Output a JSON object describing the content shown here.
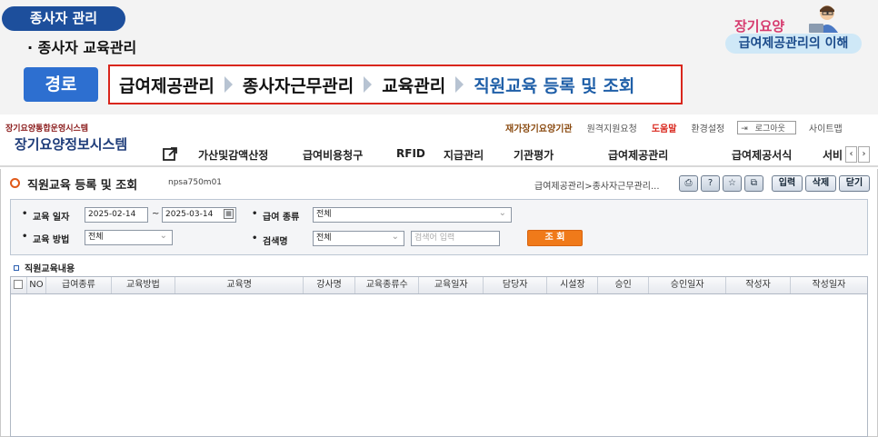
{
  "lecture": {
    "section_pill": "종사자 관리",
    "subtitle": "· 종사자 교육관리",
    "logo_text": "장기요양",
    "badge": "급여제공관리의 이해",
    "route_label": "경로",
    "route_path": [
      "급여제공관리",
      "종사자근무관리",
      "교육관리",
      "직원교육 등록 및 조회"
    ]
  },
  "app": {
    "system_small": "장기요양통합운영시스템",
    "system_name": "장기요양정보시스템",
    "toplinks": {
      "institution": "재가장기요양기관",
      "remote": "원격지원요청",
      "help": "도움말",
      "settings": "환경설정",
      "logout": "로그아웃",
      "sitemap": "사이트맵"
    },
    "menu": [
      "가산및감액산정",
      "급여비용청구",
      "RFID",
      "지급관리",
      "기관평가",
      "급여제공관리",
      "급여제공서식",
      "서비"
    ]
  },
  "screen": {
    "title": "직원교육 등록 및 조회",
    "code": "npsa750m01",
    "breadcrumb": "급여제공관리>종사자근무관리...",
    "buttons": {
      "input": "입력",
      "delete": "삭제",
      "close": "닫기"
    },
    "search": {
      "date_label": "교육 일자",
      "date_from": "2025-02-14",
      "date_to": "2025-03-14",
      "benefit_label": "급여 종류",
      "benefit_value": "전체",
      "method_label": "교육 방법",
      "method_value": "전체",
      "keyword_label": "검색명",
      "keyword_type": "전체",
      "keyword_placeholder": "검색어 입력",
      "query_button": "조 회"
    },
    "section_title": "직원교육내용",
    "columns": [
      "NO",
      "급여종류",
      "교육방법",
      "교육명",
      "강사명",
      "교육종류수",
      "교육일자",
      "담당자",
      "시설장",
      "승인",
      "승인일자",
      "작성자",
      "작성일자"
    ]
  }
}
